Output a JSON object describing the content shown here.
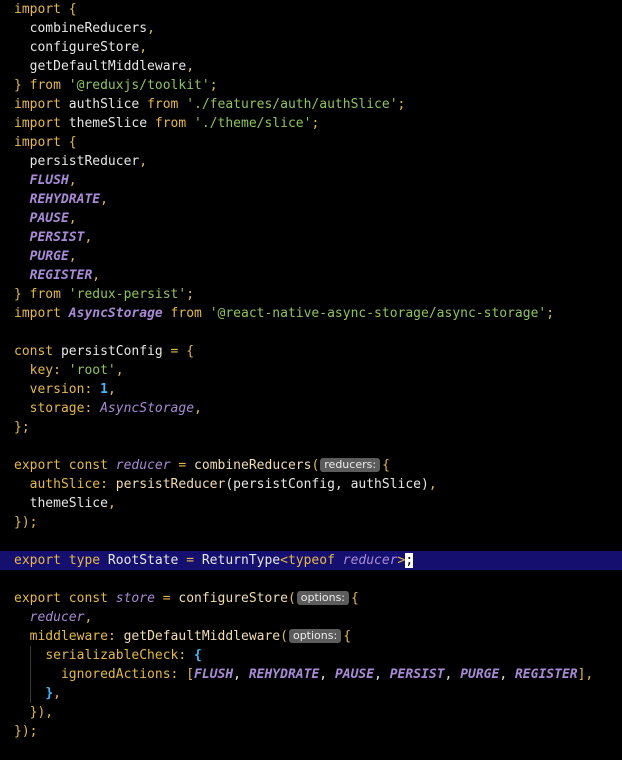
{
  "editor": {
    "file_language": "typescript",
    "active_line_index": 29,
    "colors": {
      "background": "#000000",
      "active_line": "#151070",
      "keyword": "#e5b84a",
      "string": "#8fc45a",
      "constant": "#a88ad6",
      "number": "#43b8ff",
      "inlay_hint_bg": "#5c5c5c"
    },
    "lines": [
      [
        [
          "kw",
          "import"
        ],
        [
          "plain",
          " "
        ],
        [
          "punct",
          "{"
        ]
      ],
      [
        [
          "plain",
          "  combineReducers"
        ],
        [
          "punct",
          ","
        ]
      ],
      [
        [
          "plain",
          "  configureStore"
        ],
        [
          "punct",
          ","
        ]
      ],
      [
        [
          "plain",
          "  getDefaultMiddleware"
        ],
        [
          "punct",
          ","
        ]
      ],
      [
        [
          "punct",
          "}"
        ],
        [
          "plain",
          " "
        ],
        [
          "kw",
          "from"
        ],
        [
          "plain",
          " "
        ],
        [
          "str",
          "'@reduxjs/toolkit'"
        ],
        [
          "punct",
          ";"
        ]
      ],
      [
        [
          "kw",
          "import"
        ],
        [
          "plain",
          " authSlice "
        ],
        [
          "kw",
          "from"
        ],
        [
          "plain",
          " "
        ],
        [
          "str",
          "'./features/auth/authSlice'"
        ],
        [
          "punct",
          ";"
        ]
      ],
      [
        [
          "kw",
          "import"
        ],
        [
          "plain",
          " themeSlice "
        ],
        [
          "kw",
          "from"
        ],
        [
          "plain",
          " "
        ],
        [
          "str",
          "'./theme/slice'"
        ],
        [
          "punct",
          ";"
        ]
      ],
      [
        [
          "kw",
          "import"
        ],
        [
          "plain",
          " "
        ],
        [
          "punct",
          "{"
        ]
      ],
      [
        [
          "plain",
          "  persistReducer"
        ],
        [
          "punct",
          ","
        ]
      ],
      [
        [
          "plain",
          "  "
        ],
        [
          "const",
          "FLUSH"
        ],
        [
          "punct",
          ","
        ]
      ],
      [
        [
          "plain",
          "  "
        ],
        [
          "const",
          "REHYDRATE"
        ],
        [
          "punct",
          ","
        ]
      ],
      [
        [
          "plain",
          "  "
        ],
        [
          "const",
          "PAUSE"
        ],
        [
          "punct",
          ","
        ]
      ],
      [
        [
          "plain",
          "  "
        ],
        [
          "const",
          "PERSIST"
        ],
        [
          "punct",
          ","
        ]
      ],
      [
        [
          "plain",
          "  "
        ],
        [
          "const",
          "PURGE"
        ],
        [
          "punct",
          ","
        ]
      ],
      [
        [
          "plain",
          "  "
        ],
        [
          "const",
          "REGISTER"
        ],
        [
          "punct",
          ","
        ]
      ],
      [
        [
          "punct",
          "}"
        ],
        [
          "plain",
          " "
        ],
        [
          "kw",
          "from"
        ],
        [
          "plain",
          " "
        ],
        [
          "str",
          "'redux-persist'"
        ],
        [
          "punct",
          ";"
        ]
      ],
      [
        [
          "kw",
          "import"
        ],
        [
          "plain",
          " "
        ],
        [
          "const",
          "AsyncStorage"
        ],
        [
          "plain",
          " "
        ],
        [
          "kw",
          "from"
        ],
        [
          "plain",
          " "
        ],
        [
          "str",
          "'@react-native-async-storage/async-storage'"
        ],
        [
          "punct",
          ";"
        ]
      ],
      [],
      [
        [
          "kw",
          "const"
        ],
        [
          "plain",
          " persistConfig "
        ],
        [
          "punct",
          "="
        ],
        [
          "plain",
          " "
        ],
        [
          "punct",
          "{"
        ]
      ],
      [
        [
          "plain",
          "  "
        ],
        [
          "prop",
          "key"
        ],
        [
          "punct",
          ":"
        ],
        [
          "plain",
          " "
        ],
        [
          "str",
          "'root'"
        ],
        [
          "punct",
          ","
        ]
      ],
      [
        [
          "plain",
          "  "
        ],
        [
          "prop",
          "version"
        ],
        [
          "punct",
          ":"
        ],
        [
          "plain",
          " "
        ],
        [
          "num",
          "1"
        ],
        [
          "punct",
          ","
        ]
      ],
      [
        [
          "plain",
          "  "
        ],
        [
          "prop",
          "storage"
        ],
        [
          "punct",
          ":"
        ],
        [
          "plain",
          " "
        ],
        [
          "italic-var",
          "AsyncStorage"
        ],
        [
          "punct",
          ","
        ]
      ],
      [
        [
          "punct",
          "};"
        ]
      ],
      [],
      [
        [
          "kw",
          "export"
        ],
        [
          "plain",
          " "
        ],
        [
          "kw",
          "const"
        ],
        [
          "plain",
          " "
        ],
        [
          "italic-var",
          "reducer"
        ],
        [
          "plain",
          " "
        ],
        [
          "punct",
          "="
        ],
        [
          "plain",
          " "
        ],
        [
          "fn",
          "combineReducers"
        ],
        [
          "punct",
          "("
        ],
        [
          "hint",
          "reducers:"
        ],
        [
          "punct",
          "{"
        ]
      ],
      [
        [
          "plain",
          "  "
        ],
        [
          "prop",
          "authSlice"
        ],
        [
          "punct",
          ":"
        ],
        [
          "plain",
          " "
        ],
        [
          "fn",
          "persistReducer"
        ],
        [
          "plain",
          "(persistConfig, authSlice)"
        ],
        [
          "punct",
          ","
        ]
      ],
      [
        [
          "plain",
          "  "
        ],
        [
          "plain",
          "themeSlice"
        ],
        [
          "punct",
          ","
        ]
      ],
      [
        [
          "punct",
          "});"
        ]
      ],
      [],
      [
        [
          "kw",
          "export"
        ],
        [
          "plain",
          " "
        ],
        [
          "kw",
          "type"
        ],
        [
          "plain",
          " RootState "
        ],
        [
          "punct",
          "="
        ],
        [
          "plain",
          " ReturnType"
        ],
        [
          "punct",
          "<"
        ],
        [
          "kw",
          "typeof"
        ],
        [
          "plain",
          " "
        ],
        [
          "italic-var",
          "reducer"
        ],
        [
          "punct",
          ">"
        ],
        [
          "caret",
          ";"
        ]
      ],
      [],
      [
        [
          "kw",
          "export"
        ],
        [
          "plain",
          " "
        ],
        [
          "kw",
          "const"
        ],
        [
          "plain",
          " "
        ],
        [
          "italic-var",
          "store"
        ],
        [
          "plain",
          " "
        ],
        [
          "punct",
          "="
        ],
        [
          "plain",
          " "
        ],
        [
          "fn",
          "configureStore"
        ],
        [
          "punct",
          "("
        ],
        [
          "hint",
          "options:"
        ],
        [
          "punct",
          "{"
        ]
      ],
      [
        [
          "plain",
          "  "
        ],
        [
          "italic-var",
          "reducer"
        ],
        [
          "punct",
          ","
        ]
      ],
      [
        [
          "plain",
          "  "
        ],
        [
          "prop",
          "middleware"
        ],
        [
          "punct",
          ":"
        ],
        [
          "plain",
          " "
        ],
        [
          "fn",
          "getDefaultMiddleware"
        ],
        [
          "punct",
          "("
        ],
        [
          "hint",
          "options:"
        ],
        [
          "punct",
          "{"
        ]
      ],
      [
        [
          "plain",
          "    "
        ],
        [
          "prop",
          "serializableCheck"
        ],
        [
          "punct",
          ":"
        ],
        [
          "plain",
          " "
        ],
        [
          "num",
          "{"
        ]
      ],
      [
        [
          "plain",
          "      "
        ],
        [
          "prop",
          "ignoredActions"
        ],
        [
          "punct",
          ":"
        ],
        [
          "plain",
          " "
        ],
        [
          "punct",
          "["
        ],
        [
          "const",
          "FLUSH"
        ],
        [
          "plain",
          ", "
        ],
        [
          "const",
          "REHYDRATE"
        ],
        [
          "plain",
          ", "
        ],
        [
          "const",
          "PAUSE"
        ],
        [
          "plain",
          ", "
        ],
        [
          "const",
          "PERSIST"
        ],
        [
          "plain",
          ", "
        ],
        [
          "const",
          "PURGE"
        ],
        [
          "plain",
          ", "
        ],
        [
          "const",
          "REGISTER"
        ],
        [
          "punct",
          "],"
        ]
      ],
      [
        [
          "plain",
          "    "
        ],
        [
          "num",
          "}"
        ],
        [
          "punct",
          ","
        ]
      ],
      [
        [
          "plain",
          "  "
        ],
        [
          "punct",
          "}),"
        ]
      ],
      [
        [
          "punct",
          "});"
        ]
      ]
    ]
  }
}
